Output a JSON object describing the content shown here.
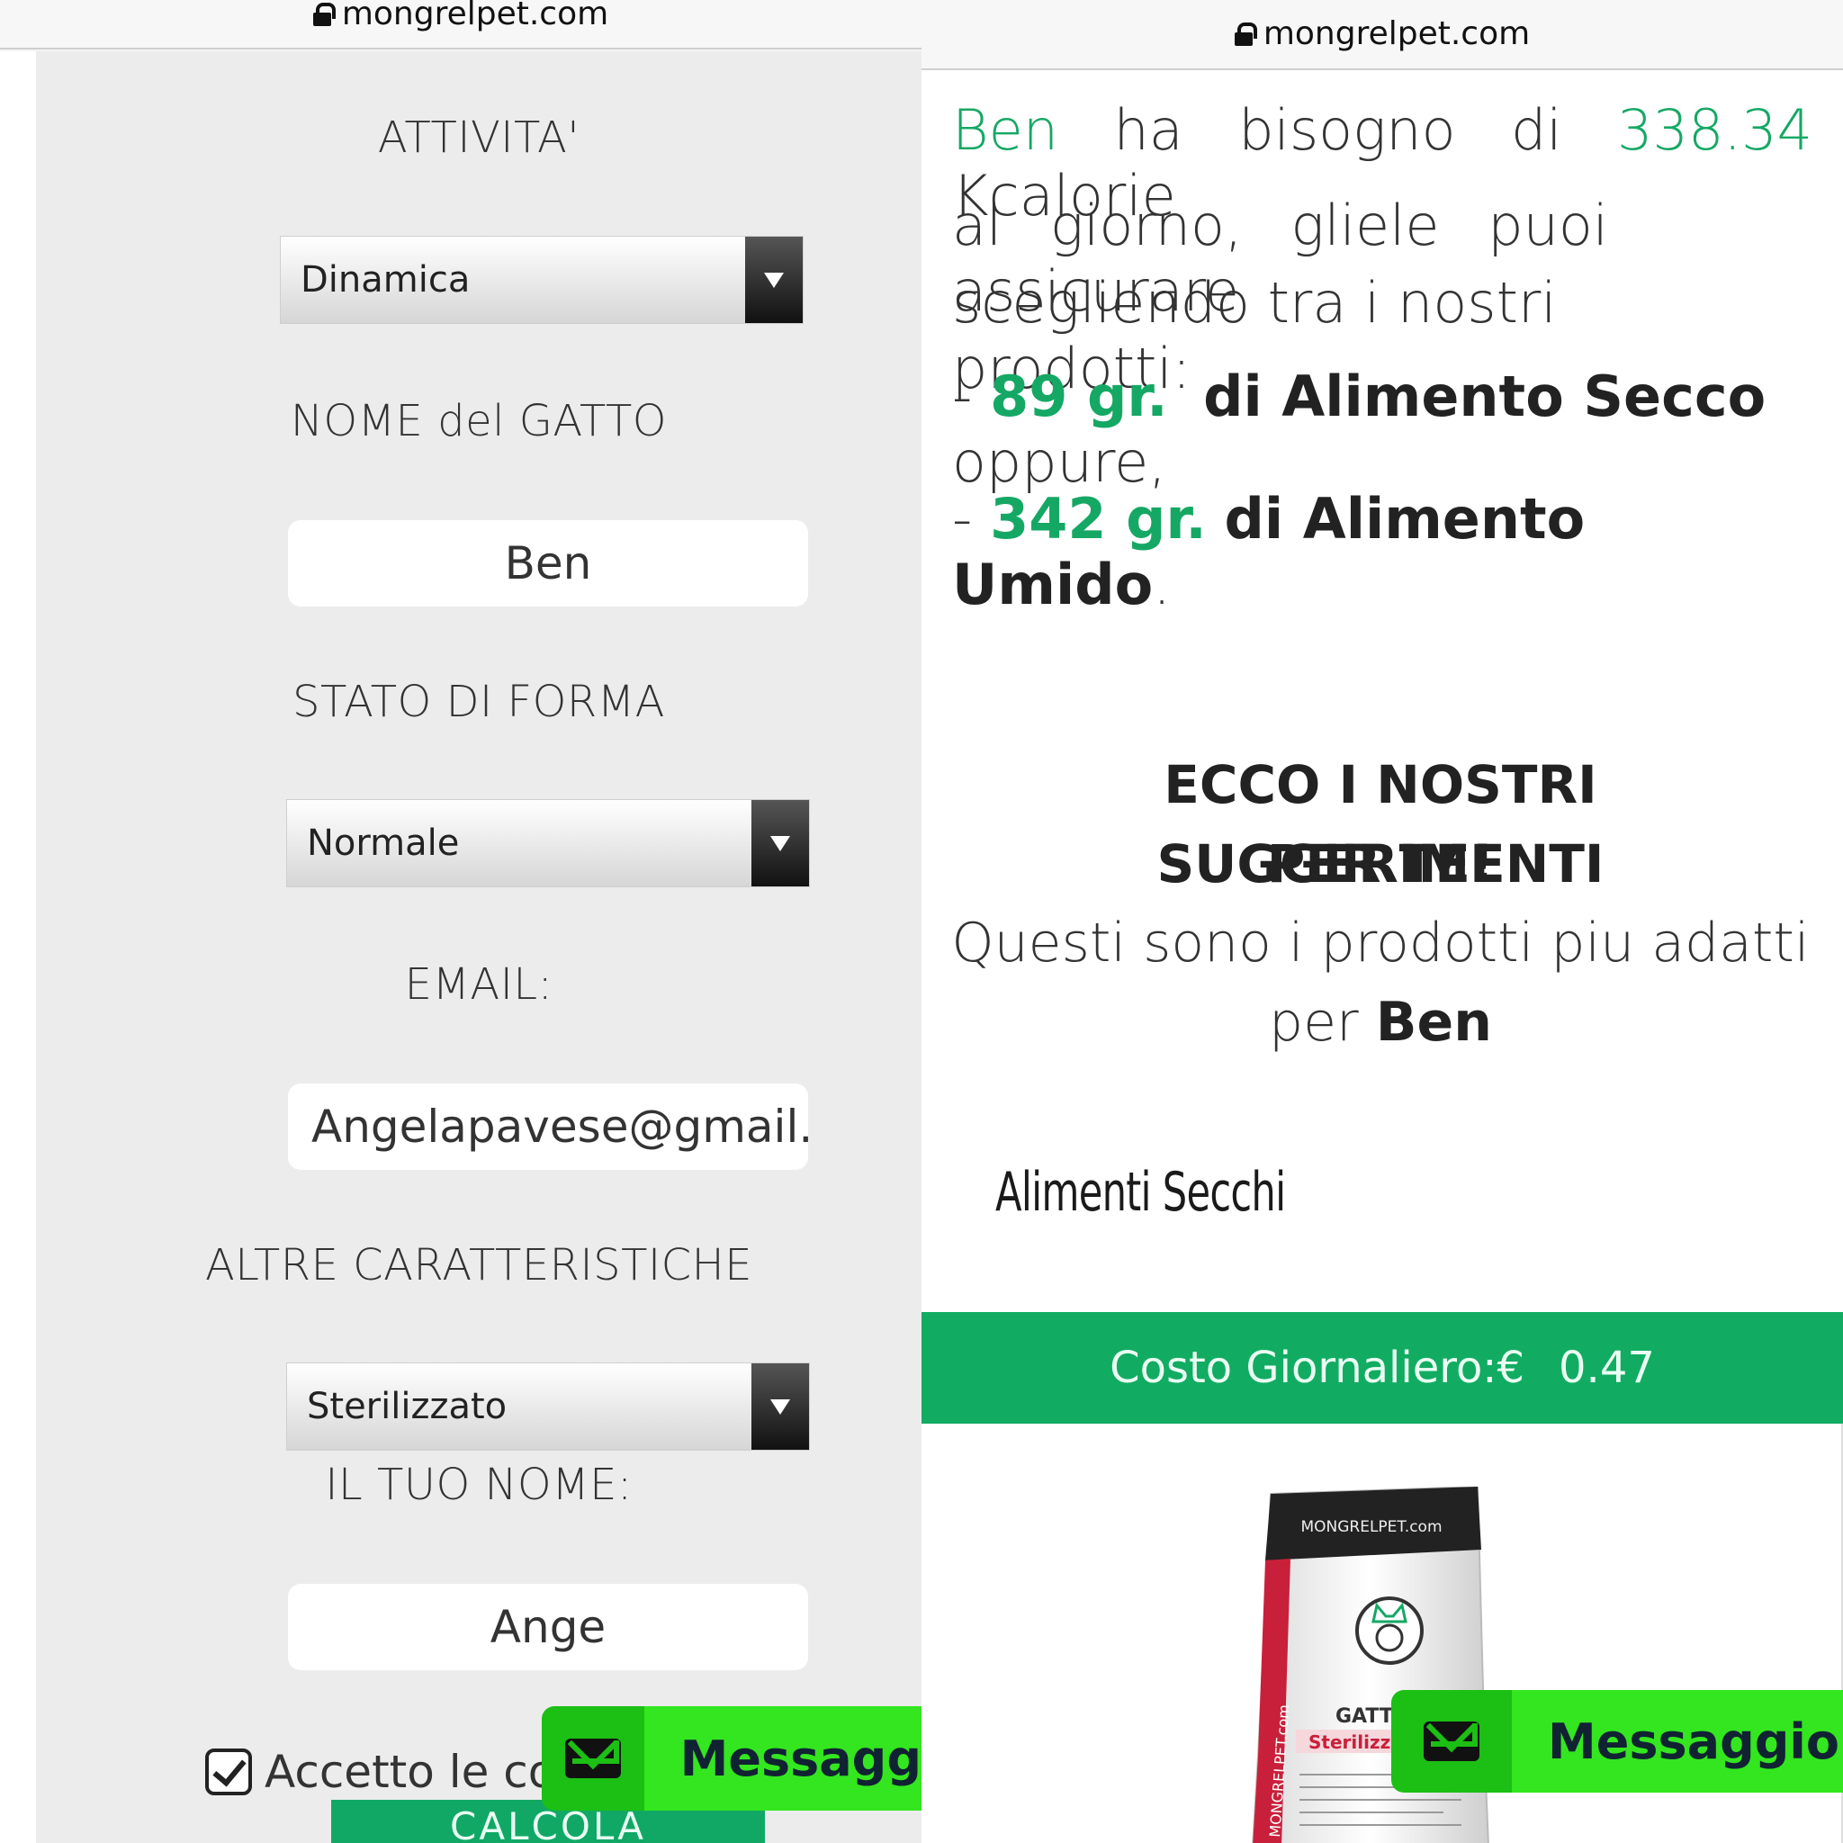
{
  "left": {
    "url": "mongrelpet.com",
    "fields": {
      "attivita_label": "ATTIVITA'",
      "attivita_value": "Dinamica",
      "nome_gatto_label": "NOME del GATTO",
      "nome_gatto_value": "Ben",
      "stato_forma_label": "STATO DI FORMA",
      "stato_forma_value": "Normale",
      "email_label": "EMAIL:",
      "email_value": "Angelapavese@gmail.c",
      "altre_label": "ALTRE CARATTERISTICHE",
      "altre_value": "Sterilizzato",
      "tuo_nome_label": "IL TUO NOME:",
      "tuo_nome_value": "Ange"
    },
    "terms_text": "Accetto le con",
    "calc_button": "CALCOLA",
    "message_button": "Messagg"
  },
  "right": {
    "url": "mongrelpet.com",
    "intro": {
      "cat_name": "Ben",
      "text_1": " ha bisogno di ",
      "kcal": "338.34",
      "text_2": " Kcalorie",
      "line_2": "al giorno, gliele puoi assicurare",
      "line_3": "scegliendo tra i nostri prodotti:"
    },
    "dry": {
      "dash": "- ",
      "amount": "89 gr.",
      "label": "di Alimento Secco",
      "suffix": " oppure,"
    },
    "wet": {
      "dash": "- ",
      "amount": "342 gr.",
      "label": "di Alimento Umido",
      "suffix": "."
    },
    "heading_1": "ECCO I NOSTRI SUGGERIMENTI",
    "heading_2": "PER TE!",
    "sub_1": "Questi sono i prodotti piu adatti",
    "sub_2_prefix": "per ",
    "sub_2_name": "Ben",
    "section_title": "Alimenti Secchi",
    "cost_label": "Costo Giornaliero:€",
    "cost_value": "0.47",
    "product": {
      "brand": "MONGRELPET.com",
      "side_text": "MONGRELPET.com",
      "line_1": "GATTI",
      "line_2": "Sterilizz"
    },
    "message_button": "Messaggio"
  },
  "colors": {
    "accent_green": "#15a864",
    "message_green": "#33e61f",
    "message_icon_green": "#1cbf14"
  }
}
